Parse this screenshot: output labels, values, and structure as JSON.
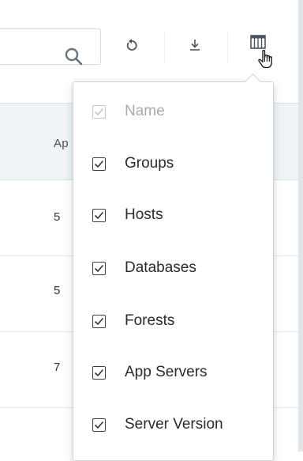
{
  "toolbar": {
    "search_icon": "search-icon",
    "refresh_icon": "refresh-icon",
    "download_icon": "download-icon",
    "columns_icon": "columns-icon",
    "cursor": "hand-pointer-icon"
  },
  "table": {
    "header_label": "Ap",
    "rows": [
      {
        "value": "5"
      },
      {
        "value": "5"
      },
      {
        "value": "7"
      }
    ]
  },
  "column_menu": {
    "items": [
      {
        "label": "Name",
        "checked": true,
        "disabled": true
      },
      {
        "label": "Groups",
        "checked": true,
        "disabled": false
      },
      {
        "label": "Hosts",
        "checked": true,
        "disabled": false
      },
      {
        "label": "Databases",
        "checked": true,
        "disabled": false
      },
      {
        "label": "Forests",
        "checked": true,
        "disabled": false
      },
      {
        "label": "App Servers",
        "checked": true,
        "disabled": false
      },
      {
        "label": "Server Version",
        "checked": true,
        "disabled": false
      }
    ]
  },
  "colors": {
    "header_bg": "#eef4f6",
    "icon": "#5a6268",
    "checkbox_border": "#404040",
    "disabled_text": "#a7abaf"
  }
}
